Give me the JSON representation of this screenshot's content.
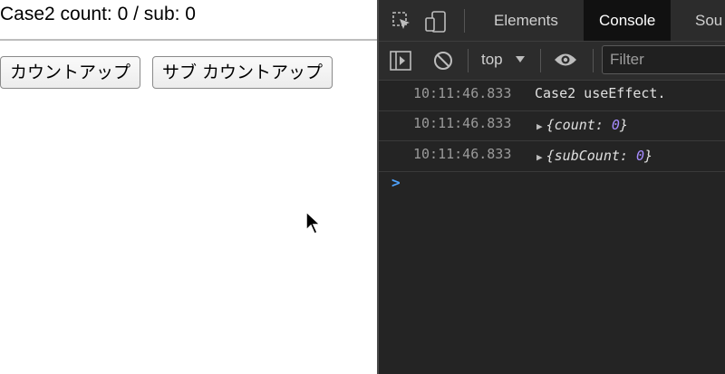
{
  "page": {
    "heading": "Case2 count: 0 / sub: 0",
    "buttons": {
      "count_up": "カウントアップ",
      "sub_count_up": "サブ カウントアップ"
    }
  },
  "devtools": {
    "tabs": [
      "Elements",
      "Console",
      "Sou"
    ],
    "active_tab": "Console",
    "toolbar": {
      "context": "top",
      "filter_placeholder": "Filter"
    },
    "console": [
      {
        "time": "10:11:46.833",
        "text": "Case2 useEffect."
      },
      {
        "time": "10:11:46.833",
        "key": "count",
        "value": "0"
      },
      {
        "time": "10:11:46.833",
        "key": "subCount",
        "value": "0"
      }
    ],
    "prompt": ">"
  },
  "colors": {
    "devtools_bg": "#242424",
    "number": "#a68cff",
    "prompt": "#4ea3ff"
  },
  "icons": [
    "inspect-icon",
    "device-toggle-icon",
    "sidebar-icon",
    "clear-icon",
    "dropdown-caret-icon",
    "eye-icon",
    "expand-triangle-icon",
    "mouse-cursor-icon"
  ]
}
